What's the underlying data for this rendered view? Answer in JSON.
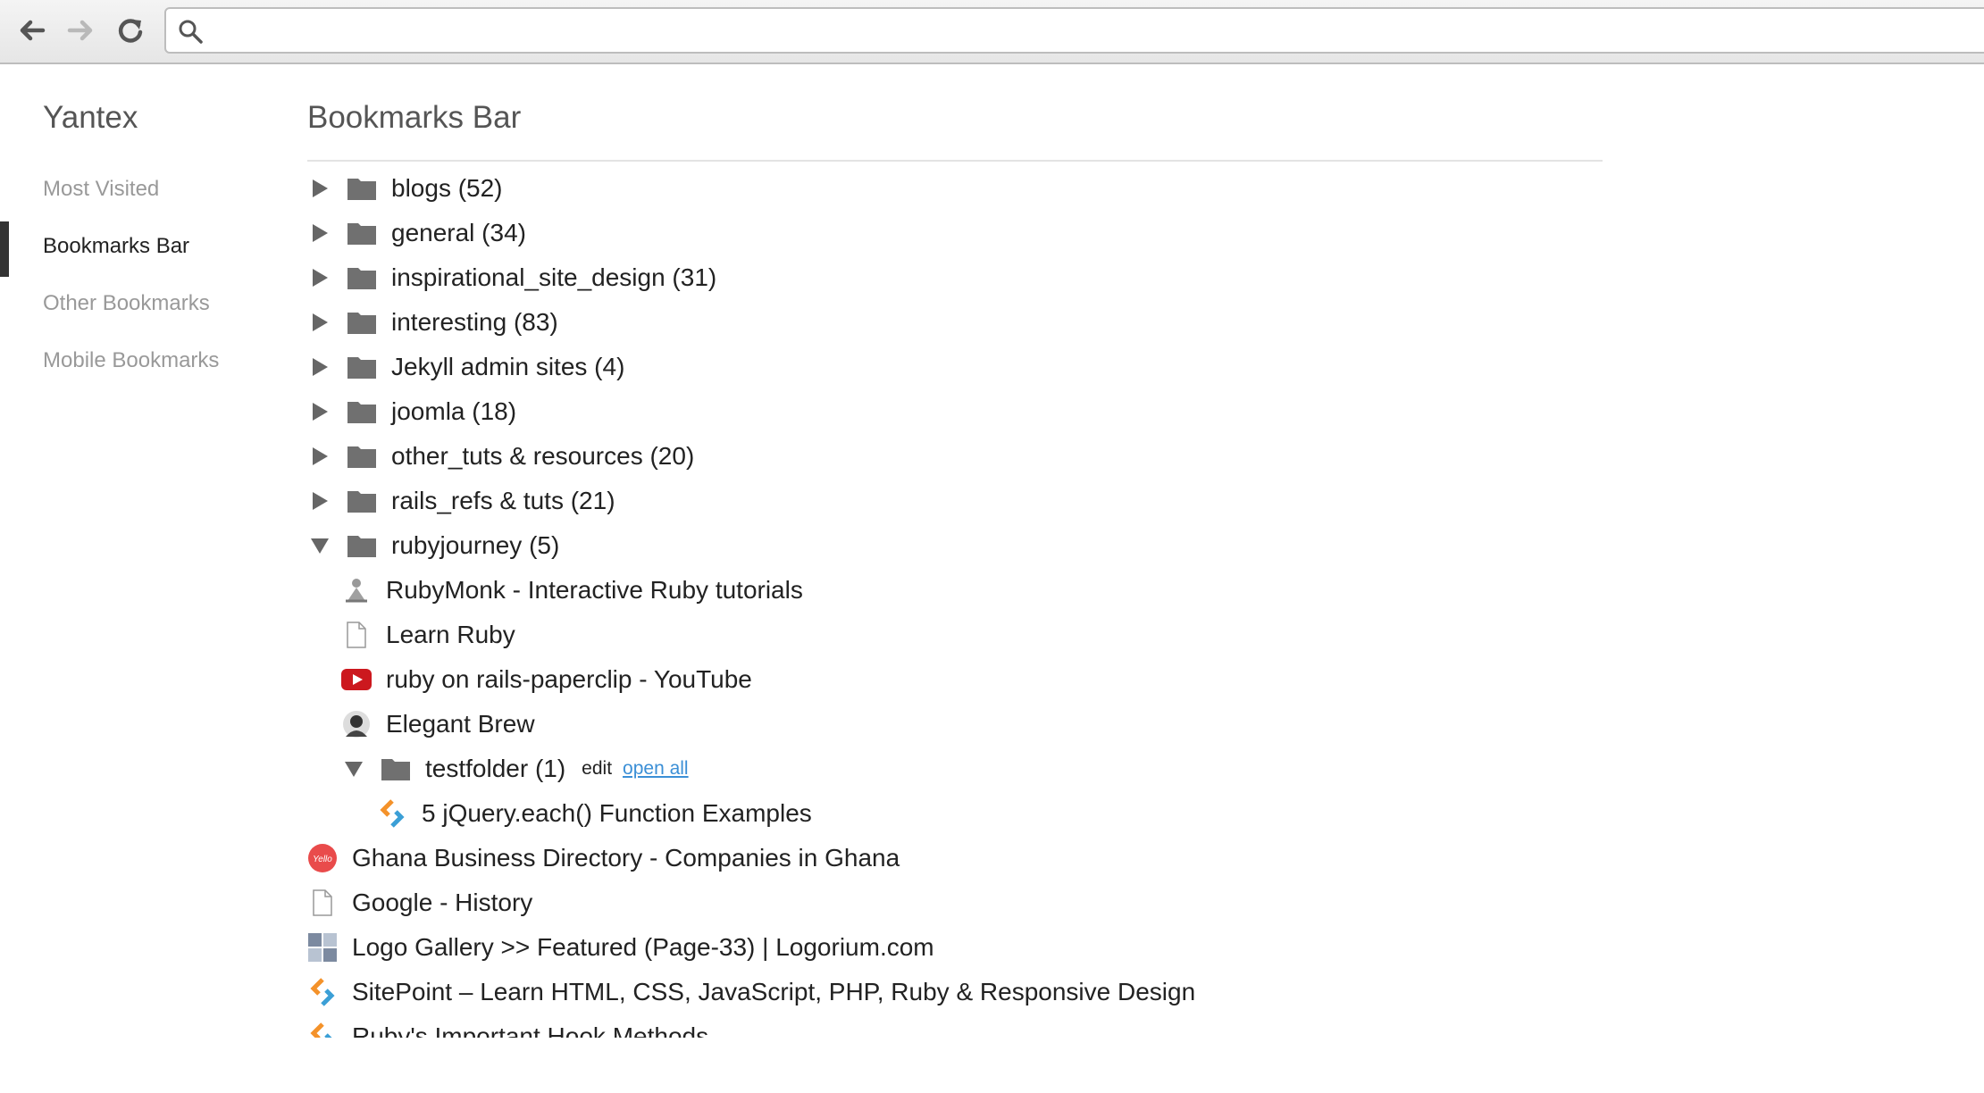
{
  "toolbar": {
    "back_icon": "arrow-left-icon",
    "forward_icon": "arrow-right-icon",
    "reload_icon": "reload-icon",
    "search_icon": "search-icon",
    "omnibox_value": ""
  },
  "sidebar": {
    "brand": "Yantex",
    "items": [
      {
        "label": "Most Visited",
        "active": false
      },
      {
        "label": "Bookmarks Bar",
        "active": true
      },
      {
        "label": "Other Bookmarks",
        "active": false
      },
      {
        "label": "Mobile Bookmarks",
        "active": false
      }
    ]
  },
  "main": {
    "title": "Bookmarks Bar",
    "folders": [
      {
        "label": "blogs (52)"
      },
      {
        "label": "general (34)"
      },
      {
        "label": "inspirational_site_design (31)"
      },
      {
        "label": "interesting (83)"
      },
      {
        "label": "Jekyll admin sites (4)"
      },
      {
        "label": "joomla (18)"
      },
      {
        "label": "other_tuts & resources (20)"
      },
      {
        "label": "rails_refs & tuts (21)"
      },
      {
        "label": "rubyjourney (5)"
      }
    ],
    "rubyjourney_children": [
      {
        "label": "RubyMonk - Interactive Ruby tutorials",
        "icon": "rubymonk-favicon-icon"
      },
      {
        "label": "Learn Ruby",
        "icon": "page-icon"
      },
      {
        "label": "ruby on rails-paperclip - YouTube",
        "icon": "youtube-icon"
      },
      {
        "label": "Elegant Brew",
        "icon": "avatar-favicon-icon"
      }
    ],
    "testfolder": {
      "label": "testfolder (1)",
      "edit": "edit",
      "open_all": "open all"
    },
    "testfolder_children": [
      {
        "label": "5 jQuery.each() Function Examples",
        "icon": "sitepoint-icon"
      }
    ],
    "bookmarks": [
      {
        "label": "Ghana Business Directory - Companies in Ghana",
        "icon": "yello-icon",
        "badge": "Yello"
      },
      {
        "label": "Google - History",
        "icon": "page-icon"
      },
      {
        "label": "Logo Gallery >> Featured (Page-33) | Logorium.com",
        "icon": "logorium-icon"
      },
      {
        "label": "SitePoint – Learn HTML, CSS, JavaScript, PHP, Ruby & Responsive Design",
        "icon": "sitepoint-icon"
      },
      {
        "label": "Ruby's Important Hook Methods",
        "icon": "sitepoint-icon"
      }
    ]
  },
  "colors": {
    "link": "#3b8fd6",
    "folder": "#707070",
    "youtube": "#cc181e",
    "sitepoint_orange": "#f4922a",
    "sitepoint_blue": "#3b9fd6",
    "yello": "#e94b4b"
  }
}
